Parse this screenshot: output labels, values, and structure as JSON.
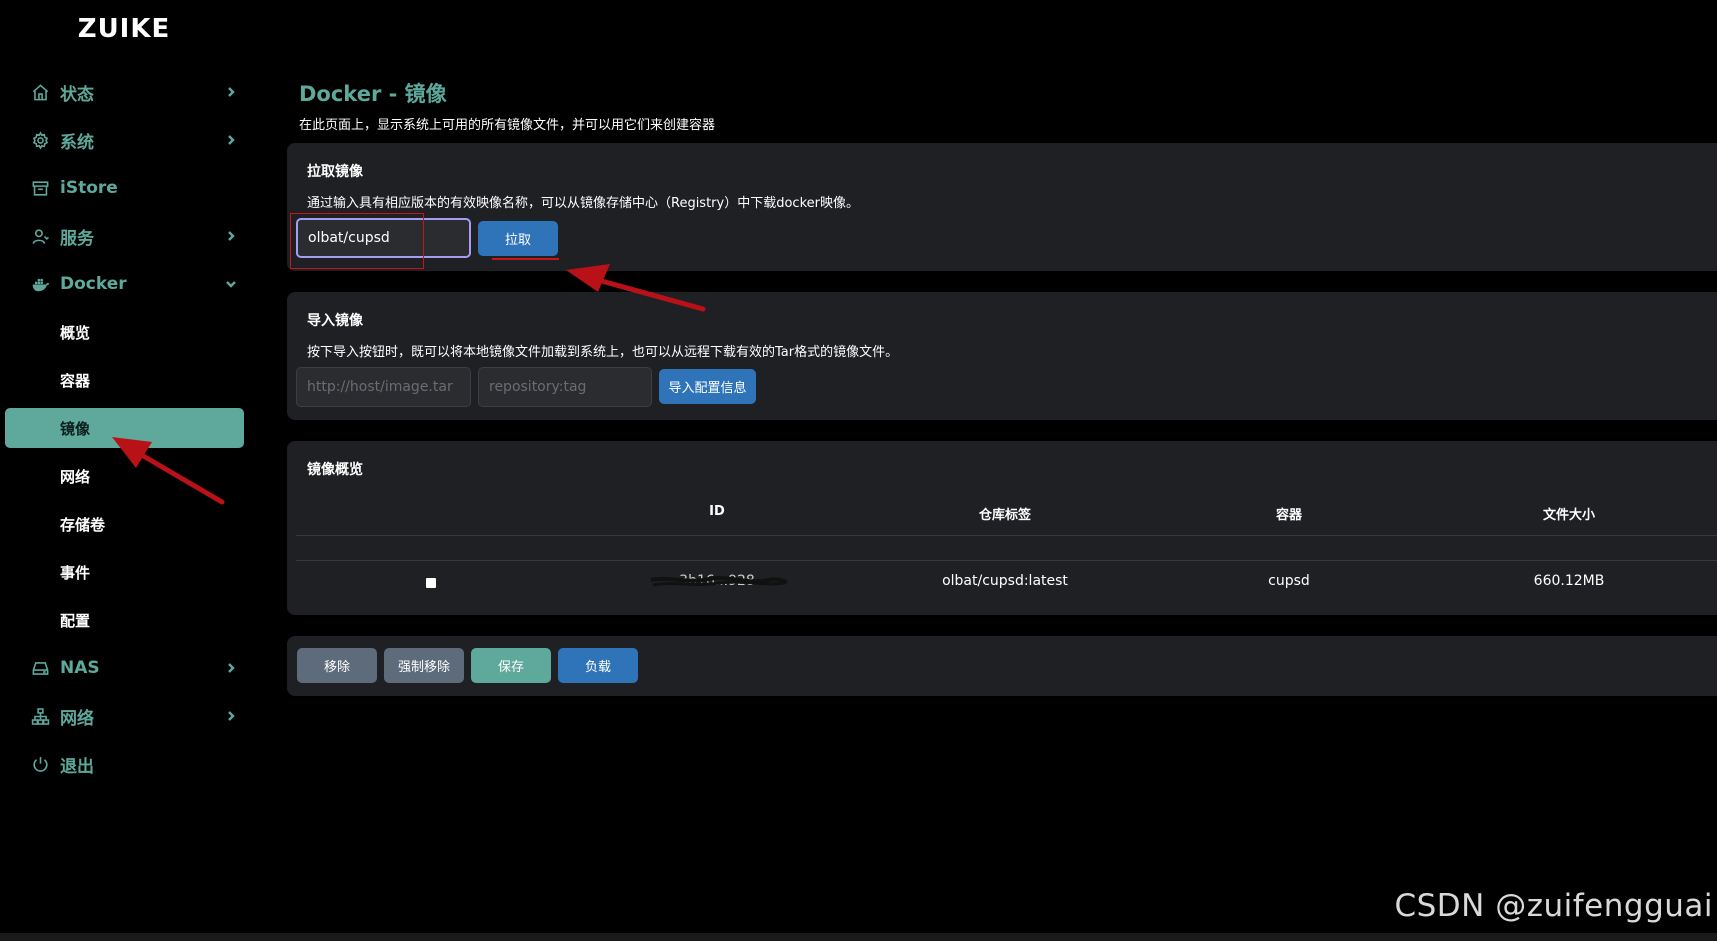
{
  "app": {
    "logo": "ZUIKE"
  },
  "sidebar": {
    "items": [
      {
        "label": "状态",
        "icon": "home-icon",
        "has_chevron": true
      },
      {
        "label": "系统",
        "icon": "gear-icon",
        "has_chevron": true
      },
      {
        "label": "iStore",
        "icon": "store-icon",
        "has_chevron": false
      },
      {
        "label": "服务",
        "icon": "user-icon",
        "has_chevron": true
      },
      {
        "label": "Docker",
        "icon": "docker-icon",
        "has_chevron": true,
        "expanded": true
      }
    ],
    "docker_sub": [
      "概览",
      "容器",
      "镜像",
      "网络",
      "存储卷",
      "事件",
      "配置"
    ],
    "docker_active": "镜像",
    "items_after": [
      {
        "label": "NAS",
        "icon": "drive-icon",
        "has_chevron": true
      },
      {
        "label": "网络",
        "icon": "network-icon",
        "has_chevron": true
      },
      {
        "label": "退出",
        "icon": "power-icon",
        "has_chevron": false
      }
    ]
  },
  "main": {
    "title": "Docker - 镜像",
    "description": "在此页面上，显示系统上可用的所有镜像文件，并可以用它们来创建容器",
    "pull": {
      "title": "拉取镜像",
      "description": "通过输入具有相应版本的有效映像名称，可以从镜像存储中心（Registry）中下载docker映像。",
      "input_value": "olbat/cupsd",
      "button": "拉取"
    },
    "import": {
      "title": "导入镜像",
      "description": "按下导入按钮时，既可以将本地镜像文件加载到系统上，也可以从远程下载有效的Tar格式的镜像文件。",
      "url_placeholder": "http://host/image.tar",
      "tag_placeholder": "repository:tag",
      "button": "导入配置信息"
    },
    "overview": {
      "title": "镜像概览",
      "columns": [
        "ID",
        "仓库标签",
        "容器",
        "文件大小"
      ],
      "rows": [
        {
          "id": "3b16...928",
          "tag": "olbat/cupsd:latest",
          "container": "cupsd",
          "size": "660.12MB"
        }
      ]
    },
    "actions": [
      "移除",
      "强制移除",
      "保存",
      "负载"
    ]
  },
  "watermark": "CSDN @zuifengguai",
  "colors": {
    "accent": "#5ea89c",
    "card_bg": "#1f2023",
    "primary_button": "#2f74b8",
    "gray_button": "#5d6b7b",
    "annotation_red": "#c8151b"
  }
}
